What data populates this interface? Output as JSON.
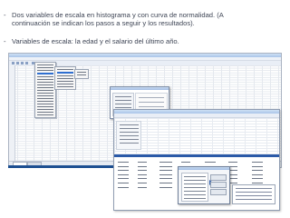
{
  "bullets": [
    {
      "marker": "-",
      "line1": "Dos variables de escala en histograma y con curva de normalidad.  (A",
      "line2": "continuación se indican los pasos a seguir y los resultados)."
    },
    {
      "marker": "-",
      "line1": "Variables de escala: la edad y el salario del último año."
    }
  ],
  "screenshots": [
    {
      "icon": "spss-data-editor-window-icon"
    },
    {
      "icon": "analysis-dialog-window-icon"
    },
    {
      "icon": "spss-output-viewer-window-icon"
    }
  ],
  "colors": {
    "text": "#3f4656",
    "accent": "#2b5aa8",
    "window_title": "#a9c4e8"
  }
}
